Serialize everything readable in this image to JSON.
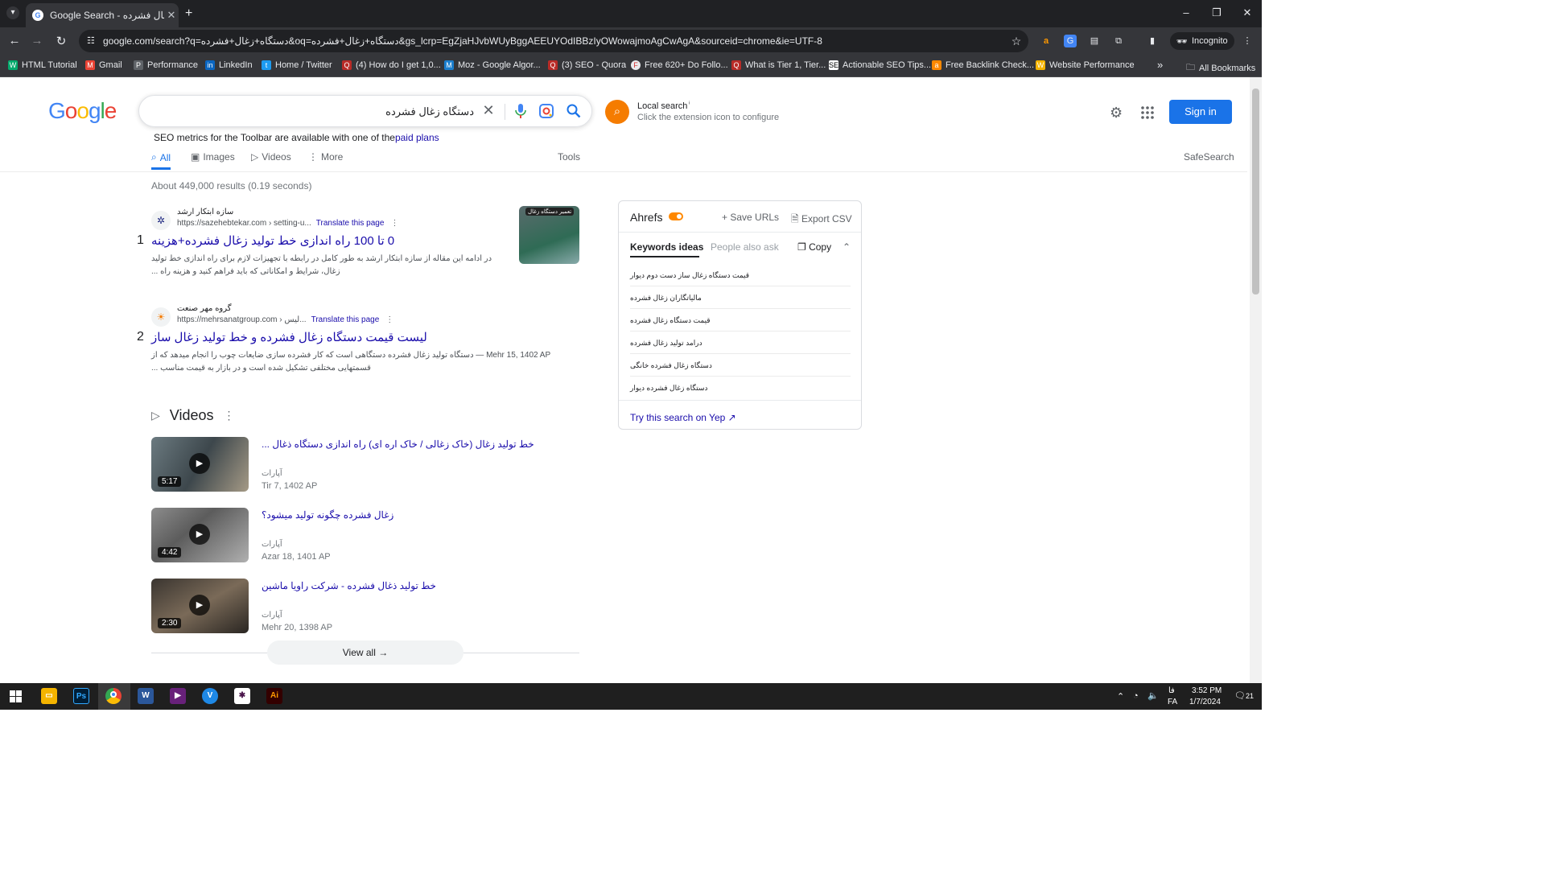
{
  "browser": {
    "tab_title": "Google Search - دستگاه زغال فشرده",
    "tab_favicon": "G",
    "url": "google.com/search?q=دستگاه+زغال+فشرده&oq=دستگاه+زغال+فشرده&gs_lcrp=EgZjaHJvbWUyBggAEEUYOdIBBzIyOWowajmoAgCwAgA&sourceid=chrome&ie=UTF-8",
    "incognito_label": "Incognito",
    "window_controls": [
      "–",
      "❐",
      "✕"
    ]
  },
  "bookmarks": {
    "items": [
      {
        "label": "HTML Tutorial",
        "icon": "W",
        "color": "#04aa6d"
      },
      {
        "label": "Gmail",
        "icon": "M",
        "color": "#ea4335"
      },
      {
        "label": "Performance",
        "icon": "P",
        "color": "#5f6368"
      },
      {
        "label": "LinkedIn",
        "icon": "in",
        "color": "#0a66c2"
      },
      {
        "label": "Home / Twitter",
        "icon": "t",
        "color": "#1d9bf0"
      },
      {
        "label": "(4) How do I get 1,0...",
        "icon": "Q",
        "color": "#b92b27"
      },
      {
        "label": "Moz - Google Algor...",
        "icon": "M",
        "color": "#1b7ecd"
      },
      {
        "label": "(3) SEO - Quora",
        "icon": "Q",
        "color": "#b92b27"
      },
      {
        "label": "Free 620+ Do Follo...",
        "icon": "F",
        "color": "#e8eaed"
      },
      {
        "label": "What is Tier 1, Tier...",
        "icon": "Q",
        "color": "#b92b27"
      },
      {
        "label": "Actionable SEO Tips...",
        "icon": "SE",
        "color": "#ffffff"
      },
      {
        "label": "Free Backlink Check...",
        "icon": "a",
        "color": "#ff8800"
      },
      {
        "label": "Website Performance",
        "icon": "W",
        "color": "#f4b400"
      }
    ],
    "all_bookmarks_label": "All Bookmarks",
    "overflow": "»"
  },
  "google": {
    "logo": "Google",
    "query": "دستگاه زغال فشرده",
    "local_search": {
      "title": "Local search",
      "subtitle": "Click the extension icon to configure"
    },
    "signin_label": "Sign in",
    "seo_note": {
      "prefix": "SEO metrics for the Toolbar are available with one of the",
      "link": "paid plans"
    },
    "tabs": [
      "All",
      "Images",
      "Videos",
      "More"
    ],
    "tools_label": "Tools",
    "safesearch_label": "SafeSearch",
    "stats": "About 449,000 results (0.19 seconds)"
  },
  "results": [
    {
      "num": "1",
      "site_name": "سازه ابتکار ارشد",
      "cite": "https://sazehebtekar.com › setting-u...",
      "translate": "Translate this page",
      "title": "0 تا 100 راه اندازی خط تولید زغال فشرده+هزینه",
      "snippet": "در ادامه این مقاله از سازه ابتکار ارشد به طور کامل در رابطه با تجهیزات لازم برای راه اندازی خط تولید زغال، شرایط و امکاناتی که باید فراهم کنید و هزینه راه ...",
      "thumb_label": "تعمیر دستگاه زغال"
    },
    {
      "num": "2",
      "site_name": "گروه مهر صنعت",
      "cite": "https://mehrsanatgroup.com › لیس...",
      "translate": "Translate this page",
      "title": "لیست قیمت دستگاه زغال فشرده و خط تولید زغال ساز",
      "snippet": "Mehr 15, 1402 AP — دستگاه تولید زغال فشرده دستگاهی است که کار فشرده سازی ضایعات چوب را انجام میدهد که از قسمتهایی مختلفی تشکیل شده است و در بازار به قیمت مناسب ..."
    }
  ],
  "videos": {
    "heading": "Videos",
    "items": [
      {
        "title": "خط تولید زغال (خاک زغالی / خاک اره ای) راه اندازی دستگاه ذغال ...",
        "source": "آپارات",
        "date": "Tir 7, 1402 AP",
        "duration": "5:17"
      },
      {
        "title": "زغال فشرده چگونه تولید میشود؟",
        "source": "آپارات",
        "date": "Azar 18, 1401 AP",
        "duration": "4:42"
      },
      {
        "title": "خط تولید ذغال فشرده - شرکت راویا ماشین",
        "source": "آپارات",
        "date": "Mehr 20, 1398 AP",
        "duration": "2:30"
      }
    ],
    "view_all": "View all"
  },
  "ahrefs": {
    "title": "Ahrefs",
    "save_urls": "Save URLs",
    "export_csv": "Export CSV",
    "tab_keywords": "Keywords ideas",
    "tab_people": "People also ask",
    "copy": "Copy",
    "keywords": [
      "قیمت دستگاه زغال ساز دست دوم دیوار",
      "مالیاتگاران زغال فشرده",
      "قیمت دستگاه زغال فشرده",
      "درامد تولید زغال فشرده",
      "دستگاه زغال فشرده خانگی",
      "دستگاه زغال فشرده دیوار"
    ],
    "try_yep": "Try this search on Yep"
  },
  "taskbar": {
    "time": "3:52 PM",
    "date": "1/7/2024",
    "lang1": "فا",
    "lang2": "FA",
    "notifications": "21",
    "apps": [
      {
        "name": "file-explorer",
        "label": "",
        "color": "#f4b400"
      },
      {
        "name": "photoshop",
        "label": "Ps",
        "color": "#001e36"
      },
      {
        "name": "chrome",
        "label": "",
        "color": "#4285f4"
      },
      {
        "name": "word",
        "label": "W",
        "color": "#2b579a"
      },
      {
        "name": "visual-studio",
        "label": "",
        "color": "#68217a"
      },
      {
        "name": "app-v",
        "label": "V",
        "color": "#1e88e5"
      },
      {
        "name": "slack",
        "label": "",
        "color": "#4a154b"
      },
      {
        "name": "illustrator",
        "label": "Ai",
        "color": "#330000"
      }
    ]
  }
}
